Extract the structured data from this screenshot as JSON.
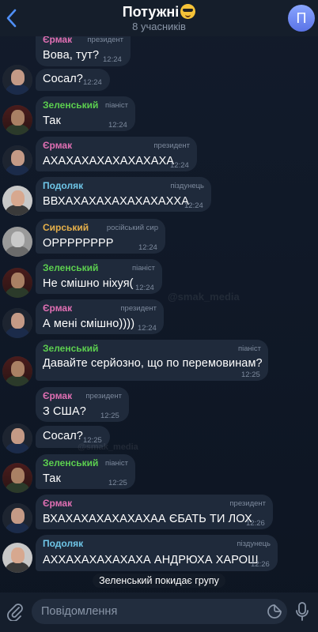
{
  "header": {
    "back_icon": "chevron-left-icon",
    "title": "Потужні",
    "title_emoji": "sunglasses-emoji-icon",
    "subtitle": "8 учасників",
    "avatar_letter": "П"
  },
  "messages": [
    {
      "sender": "Єрмак",
      "role": "президент",
      "text": "Вова, тут?",
      "time": "12:24",
      "color": "#e06fb3",
      "avatar": "yermak"
    },
    {
      "sender": "",
      "role": "",
      "text": "Сосал?",
      "time": "12:24",
      "color": "",
      "avatar": "yermak"
    },
    {
      "sender": "Зеленський",
      "role": "піаніст",
      "text": "Так",
      "time": "12:24",
      "color": "#5ccf4f",
      "avatar": "zelensky"
    },
    {
      "sender": "Єрмак",
      "role": "президент",
      "text": "АХАХАХАХАХАХАХАХА",
      "time": "12:24",
      "color": "#e06fb3",
      "avatar": "yermak"
    },
    {
      "sender": "Подоляк",
      "role": "піздунець",
      "text": "ВВХАХАХАХАХАХАХАХХА",
      "time": "12:24",
      "color": "#6fc6e8",
      "avatar": "podolyak"
    },
    {
      "sender": "Сирський",
      "role": "російський сир",
      "text": "ОРРРРРРРР",
      "time": "12:24",
      "color": "#e6b04a",
      "avatar": "syrsky"
    },
    {
      "sender": "Зеленський",
      "role": "піаніст",
      "text": "Не смішно ніхуя(",
      "time": "12:24",
      "color": "#5ccf4f",
      "avatar": "zelensky"
    },
    {
      "sender": "Єрмак",
      "role": "президент",
      "text": "А мені смішно))))",
      "time": "12:24",
      "color": "#e06fb3",
      "avatar": "yermak"
    },
    {
      "sender": "Зеленський",
      "role": "піаніст",
      "text": "Давайте серйозно, що по перемовинам?",
      "time": "12:25",
      "color": "#5ccf4f",
      "avatar": "zelensky"
    },
    {
      "sender": "Єрмак",
      "role": "президент",
      "text": "З США?",
      "time": "12:25",
      "color": "#e06fb3",
      "avatar": "yermak"
    },
    {
      "sender": "",
      "role": "",
      "text": "Сосал?",
      "time": "12:25",
      "color": "",
      "avatar": "yermak"
    },
    {
      "sender": "Зеленський",
      "role": "піаніст",
      "text": "Так",
      "time": "12:25",
      "color": "#5ccf4f",
      "avatar": "zelensky"
    },
    {
      "sender": "Єрмак",
      "role": "президент",
      "text": "ВХАХАХАХАХАХАХАА ЄБАТЬ ТИ ЛОХ",
      "time": "12:26",
      "color": "#e06fb3",
      "avatar": "yermak"
    },
    {
      "sender": "Подоляк",
      "role": "піздунець",
      "text": "АХХАХАХАХАХАХА АНДРЮХА ХАРОШ",
      "time": "12:26",
      "color": "#6fc6e8",
      "avatar": "podolyak"
    }
  ],
  "watermark": "@smak_media",
  "service_message": "Зеленський покидає групу",
  "input": {
    "placeholder": "Повідомлення",
    "attach_icon": "paperclip-icon",
    "sticker_icon": "sticker-icon",
    "mic_icon": "microphone-icon"
  }
}
